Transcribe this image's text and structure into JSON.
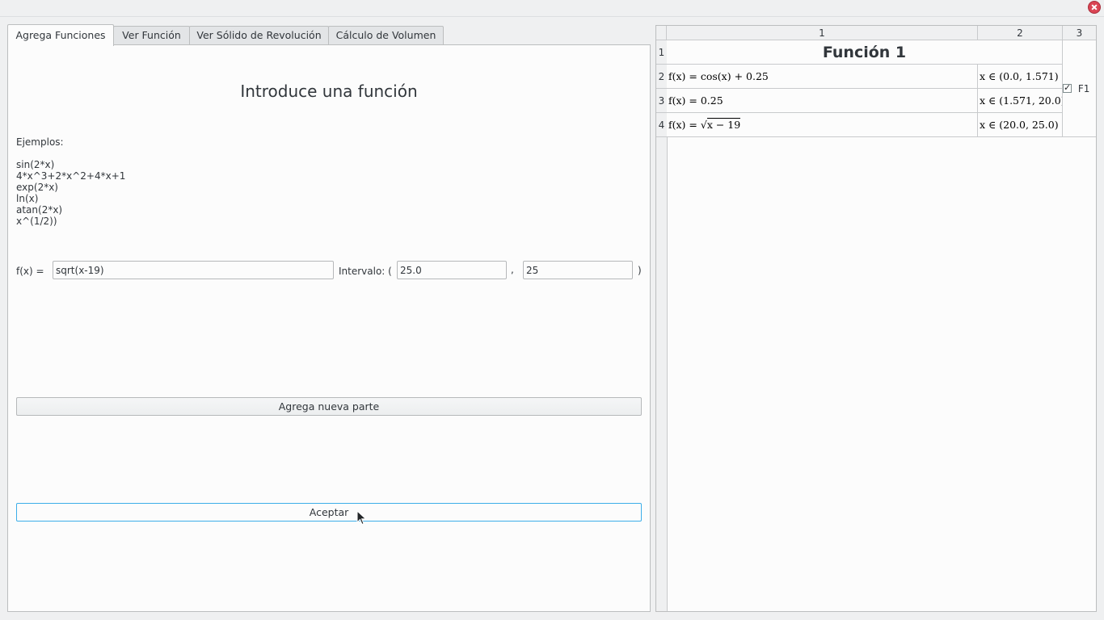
{
  "window": {
    "close_icon": "close-icon"
  },
  "tabs": [
    {
      "label": "Agrega Funciones",
      "active": true
    },
    {
      "label": "Ver Función",
      "active": false
    },
    {
      "label": "Ver Sólido de Revolución",
      "active": false
    },
    {
      "label": "Cálculo de Volumen",
      "active": false
    }
  ],
  "form": {
    "heading": "Introduce una función",
    "examples_label": "Ejemplos:",
    "examples": [
      "sin(2*x)",
      "4*x^3+2*x^2+4*x+1",
      "exp(2*x)",
      "ln(x)",
      "atan(2*x)",
      "x^(1/2))"
    ],
    "fx_label": "f(x) =",
    "fx_value": "sqrt(x-19)",
    "interval_label": "Intervalo: (",
    "interval_start": "25.0",
    "comma": ",",
    "interval_end": "25",
    "close_paren": ")",
    "add_part_button": "Agrega nueva parte",
    "accept_button": "Aceptar"
  },
  "sheet": {
    "col_headers": [
      "1",
      "2",
      "3"
    ],
    "row_headers": [
      "1",
      "2",
      "3",
      "4"
    ],
    "title": "Función 1",
    "rows": [
      {
        "f_prefix": "f(x) = ",
        "f_expr": "cos(x) + 0.25",
        "interval": "x ∈ (0.0, 1.571)"
      },
      {
        "f_prefix": "f(x) = ",
        "f_expr": "0.25",
        "interval": "x ∈ (1.571, 20.0)"
      },
      {
        "f_prefix": "f(x) = √",
        "f_expr": "x − 19",
        "interval": "x ∈ (20.0, 25.0)"
      }
    ],
    "checkbox_label": "F1",
    "checkbox_checked": true
  }
}
